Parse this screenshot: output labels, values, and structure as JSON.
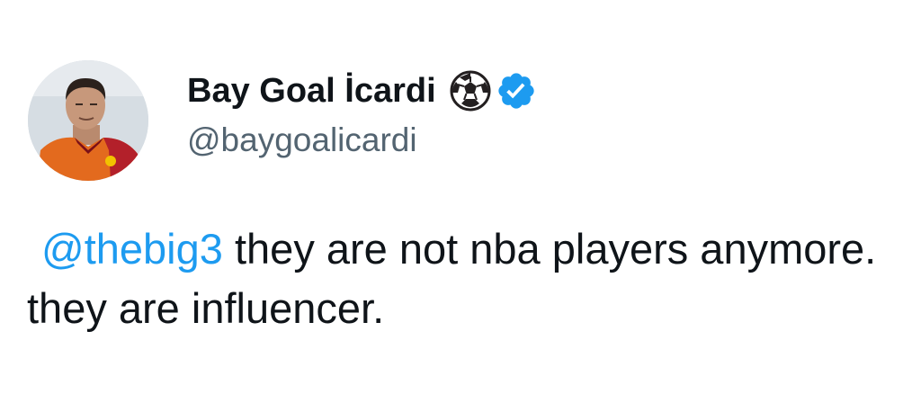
{
  "author": {
    "display_name": "Bay Goal İcardi",
    "handle": "@baygoalicardi",
    "avatar_icon": "profile-photo",
    "name_emoji_icon": "soccer-ball-icon",
    "verified_icon": "verified-badge-icon"
  },
  "tweet": {
    "mention": "@thebig3",
    "text_rest": " they are not nba players anymore. they are influencer."
  },
  "colors": {
    "mention": "#1d9bf0",
    "verified": "#1d9bf0",
    "handle": "#536471",
    "text": "#0f1419"
  }
}
